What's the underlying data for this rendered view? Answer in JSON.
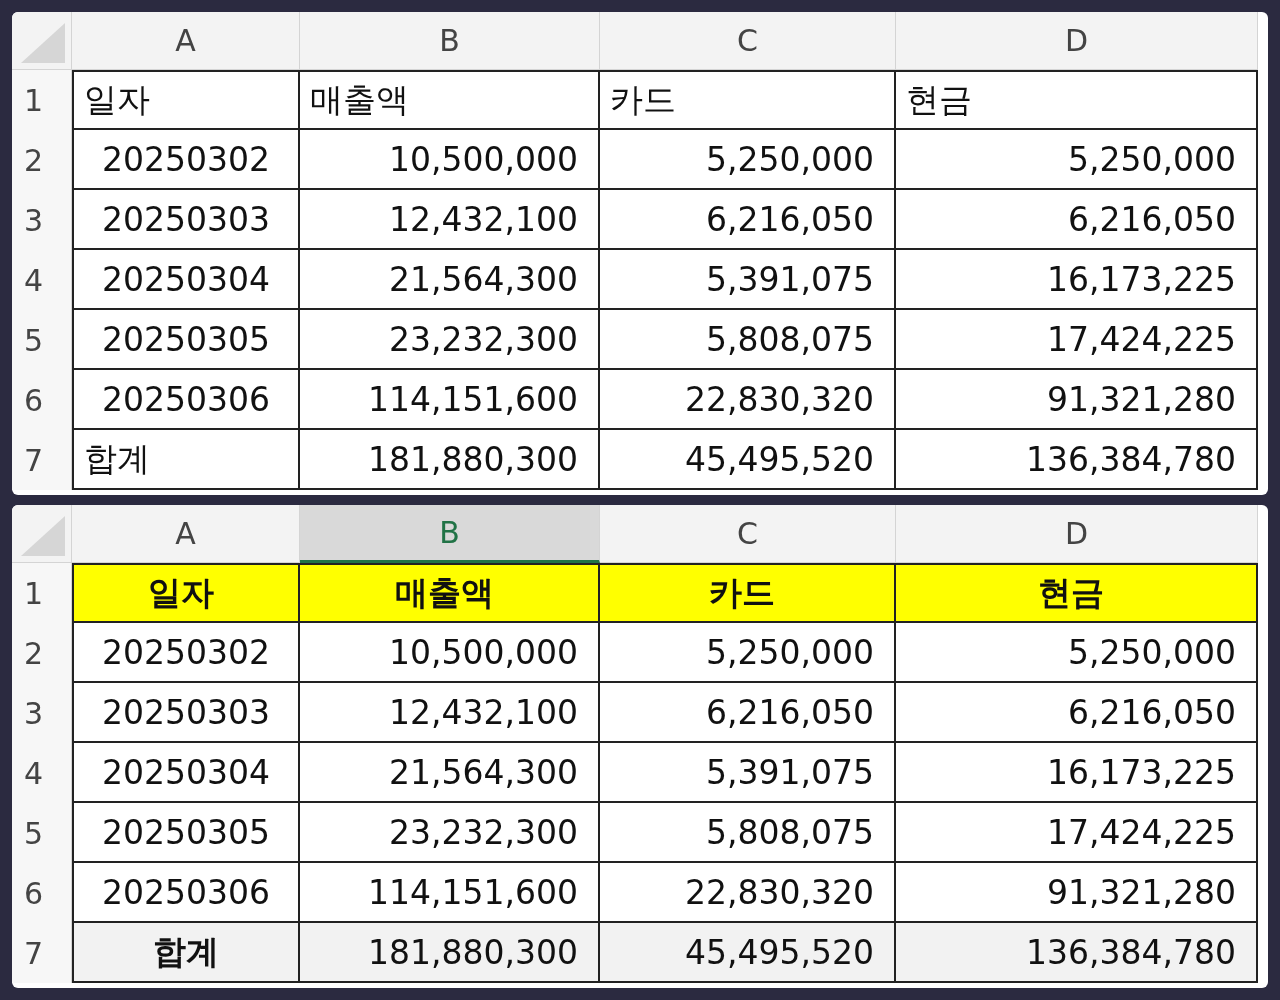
{
  "sheets": [
    {
      "formatted": false,
      "columns": [
        {
          "label": "A",
          "selected": false
        },
        {
          "label": "B",
          "selected": false
        },
        {
          "label": "C",
          "selected": false
        },
        {
          "label": "D",
          "selected": false
        }
      ],
      "rows": [
        {
          "number": "1",
          "kind": "header",
          "cells": [
            "일자",
            "매출액",
            "카드",
            "현금"
          ]
        },
        {
          "number": "2",
          "kind": "data",
          "cells": [
            "20250302",
            "10,500,000",
            "5,250,000",
            "5,250,000"
          ]
        },
        {
          "number": "3",
          "kind": "data",
          "cells": [
            "20250303",
            "12,432,100",
            "6,216,050",
            "6,216,050"
          ]
        },
        {
          "number": "4",
          "kind": "data",
          "cells": [
            "20250304",
            "21,564,300",
            "5,391,075",
            "16,173,225"
          ]
        },
        {
          "number": "5",
          "kind": "data",
          "cells": [
            "20250305",
            "23,232,300",
            "5,808,075",
            "17,424,225"
          ]
        },
        {
          "number": "6",
          "kind": "data",
          "cells": [
            "20250306",
            "114,151,600",
            "22,830,320",
            "91,321,280"
          ]
        },
        {
          "number": "7",
          "kind": "total",
          "cells": [
            "합계",
            "181,880,300",
            "45,495,520",
            "136,384,780"
          ]
        }
      ]
    },
    {
      "formatted": true,
      "columns": [
        {
          "label": "A",
          "selected": false
        },
        {
          "label": "B",
          "selected": true
        },
        {
          "label": "C",
          "selected": false
        },
        {
          "label": "D",
          "selected": false
        }
      ],
      "rows": [
        {
          "number": "1",
          "kind": "header",
          "cells": [
            "일자",
            "매출액",
            "카드",
            "현금"
          ]
        },
        {
          "number": "2",
          "kind": "data",
          "cells": [
            "20250302",
            "10,500,000",
            "5,250,000",
            "5,250,000"
          ]
        },
        {
          "number": "3",
          "kind": "data",
          "cells": [
            "20250303",
            "12,432,100",
            "6,216,050",
            "6,216,050"
          ]
        },
        {
          "number": "4",
          "kind": "data",
          "cells": [
            "20250304",
            "21,564,300",
            "5,391,075",
            "16,173,225"
          ]
        },
        {
          "number": "5",
          "kind": "data",
          "cells": [
            "20250305",
            "23,232,300",
            "5,808,075",
            "17,424,225"
          ]
        },
        {
          "number": "6",
          "kind": "data",
          "cells": [
            "20250306",
            "114,151,600",
            "22,830,320",
            "91,321,280"
          ]
        },
        {
          "number": "7",
          "kind": "total",
          "cells": [
            "합계",
            "181,880,300",
            "45,495,520",
            "136,384,780"
          ]
        }
      ]
    }
  ]
}
